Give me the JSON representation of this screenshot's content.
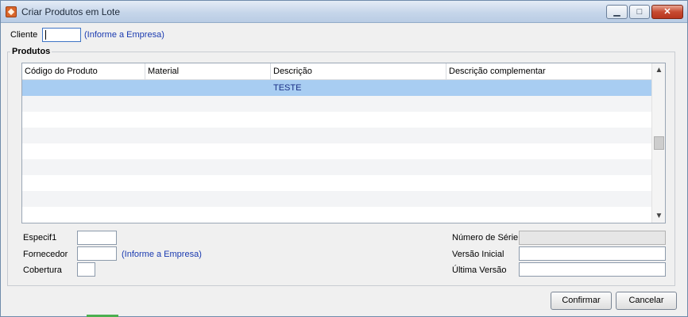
{
  "window": {
    "title": "Criar Produtos em Lote",
    "minimize_glyph": "▁",
    "maximize_glyph": "□",
    "close_glyph": "✕"
  },
  "cliente": {
    "label": "Cliente",
    "value": "",
    "hint": "(Informe a Empresa)"
  },
  "produtos": {
    "group_title": "Produtos",
    "columns": [
      "Código do Produto",
      "Material",
      "Descrição",
      "Descrição complementar"
    ],
    "rows": [
      {
        "codigo": "",
        "material": "",
        "descricao": "TESTE",
        "complementar": "",
        "selected": true
      },
      {
        "codigo": "",
        "material": "",
        "descricao": "",
        "complementar": ""
      },
      {
        "codigo": "",
        "material": "",
        "descricao": "",
        "complementar": ""
      },
      {
        "codigo": "",
        "material": "",
        "descricao": "",
        "complementar": ""
      },
      {
        "codigo": "",
        "material": "",
        "descricao": "",
        "complementar": ""
      },
      {
        "codigo": "",
        "material": "",
        "descricao": "",
        "complementar": ""
      },
      {
        "codigo": "",
        "material": "",
        "descricao": "",
        "complementar": ""
      },
      {
        "codigo": "",
        "material": "",
        "descricao": "",
        "complementar": ""
      },
      {
        "codigo": "",
        "material": "",
        "descricao": "",
        "complementar": ""
      }
    ],
    "scroll_up_glyph": "▲",
    "scroll_down_glyph": "▼"
  },
  "fields": {
    "especif1_label": "Especif1",
    "especif1_value": "",
    "fornecedor_label": "Fornecedor",
    "fornecedor_value": "",
    "fornecedor_hint": "(Informe a Empresa)",
    "cobertura_label": "Cobertura",
    "cobertura_value": "",
    "numero_serie_label": "Número de Série",
    "numero_serie_value": "",
    "versao_inicial_label": "Versão Inicial",
    "versao_inicial_value": "",
    "ultima_versao_label": "Última Versão",
    "ultima_versao_value": ""
  },
  "buttons": {
    "confirmar": "Confirmar",
    "cancelar": "Cancelar"
  },
  "colors": {
    "selection": "#a8cdf2",
    "hint_text": "#1a3ab0"
  }
}
